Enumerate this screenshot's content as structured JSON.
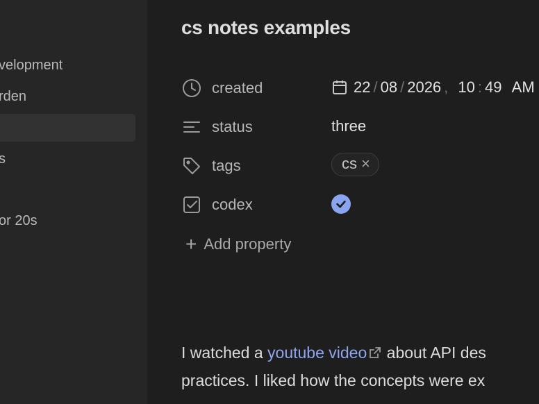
{
  "sidebar": {
    "items": [
      {
        "label": "velopment"
      },
      {
        "label": "rden"
      },
      {
        "label": ""
      },
      {
        "label": "s"
      },
      {
        "label": "or 20s"
      }
    ]
  },
  "note": {
    "title": "cs notes examples",
    "properties": [
      {
        "icon": "clock-icon",
        "label": "created",
        "value": {
          "day": "22",
          "month": "08",
          "year": "2026",
          "hour": "10",
          "minute": "49",
          "ampm": "AM"
        }
      },
      {
        "icon": "text-lines-icon",
        "label": "status",
        "value": "three"
      },
      {
        "icon": "tag-icon",
        "label": "tags",
        "tags": [
          "cs"
        ]
      },
      {
        "icon": "checkbox-icon",
        "label": "codex",
        "checked": true
      }
    ],
    "add_property": "Add property",
    "body": {
      "line1_before": "I watched a ",
      "link": "youtube video",
      "line1_after": " about API des",
      "line2": "practices. I liked how the concepts were ex"
    }
  },
  "colors": {
    "accent": "#8aa4f0",
    "link": "#8fa6ef",
    "background": "#1e1e1e",
    "sidebar": "#262626"
  }
}
